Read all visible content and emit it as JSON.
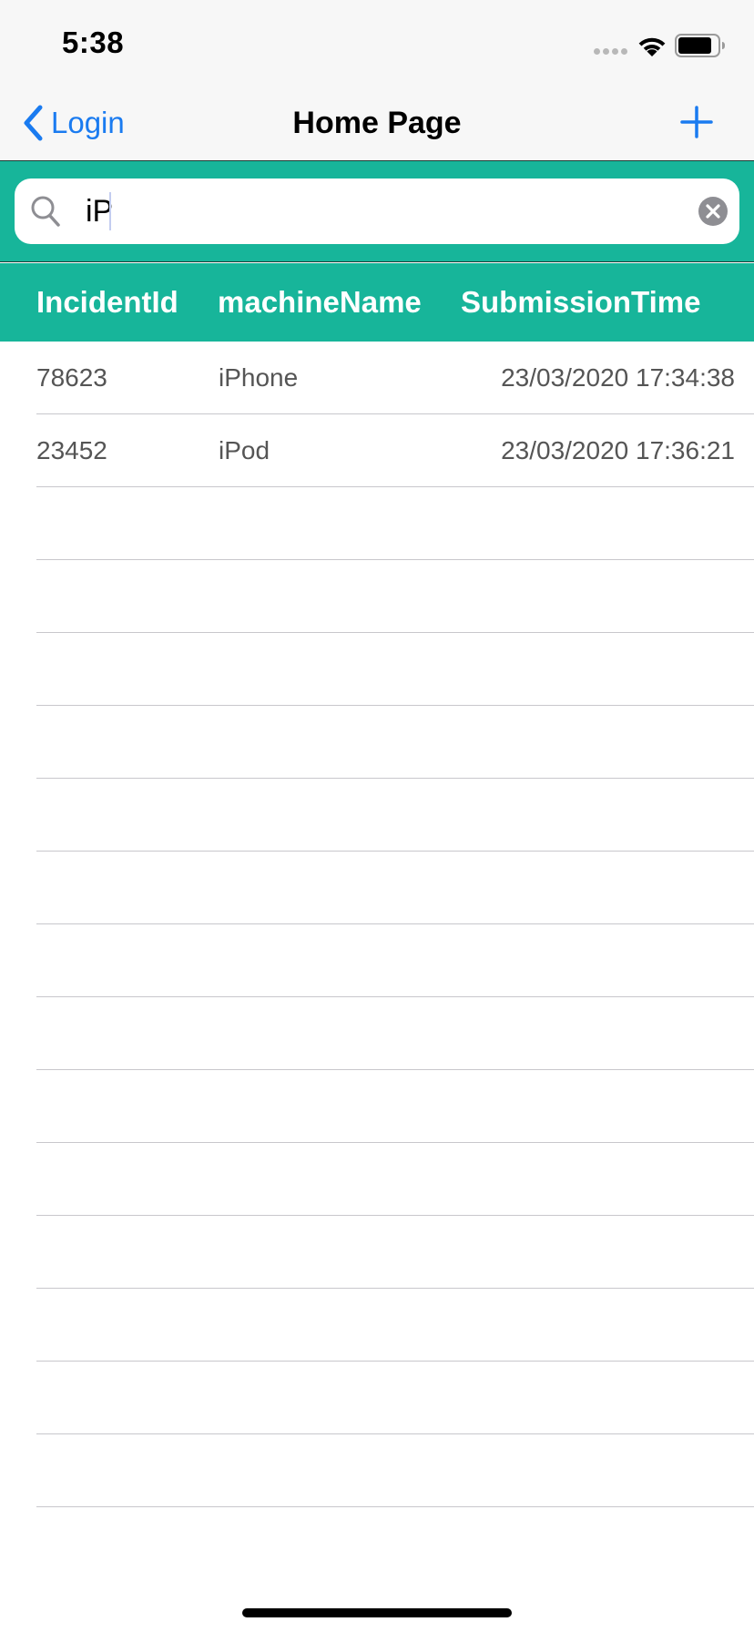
{
  "status_bar": {
    "time": "5:38"
  },
  "nav": {
    "back_label": "Login",
    "title": "Home Page",
    "accent_color": "#1a7bf0"
  },
  "search": {
    "value": "iP",
    "icon": "search-icon",
    "clear_icon": "clear-icon"
  },
  "table": {
    "header_color": "#17b59a",
    "columns": [
      "IncidentId",
      "machineName",
      "SubmissionTime"
    ],
    "rows": [
      {
        "incident_id": "78623",
        "machine_name": "iPhone",
        "submission_time": "23/03/2020 17:34:38"
      },
      {
        "incident_id": "23452",
        "machine_name": "iPod",
        "submission_time": "23/03/2020 17:36:21"
      }
    ]
  }
}
